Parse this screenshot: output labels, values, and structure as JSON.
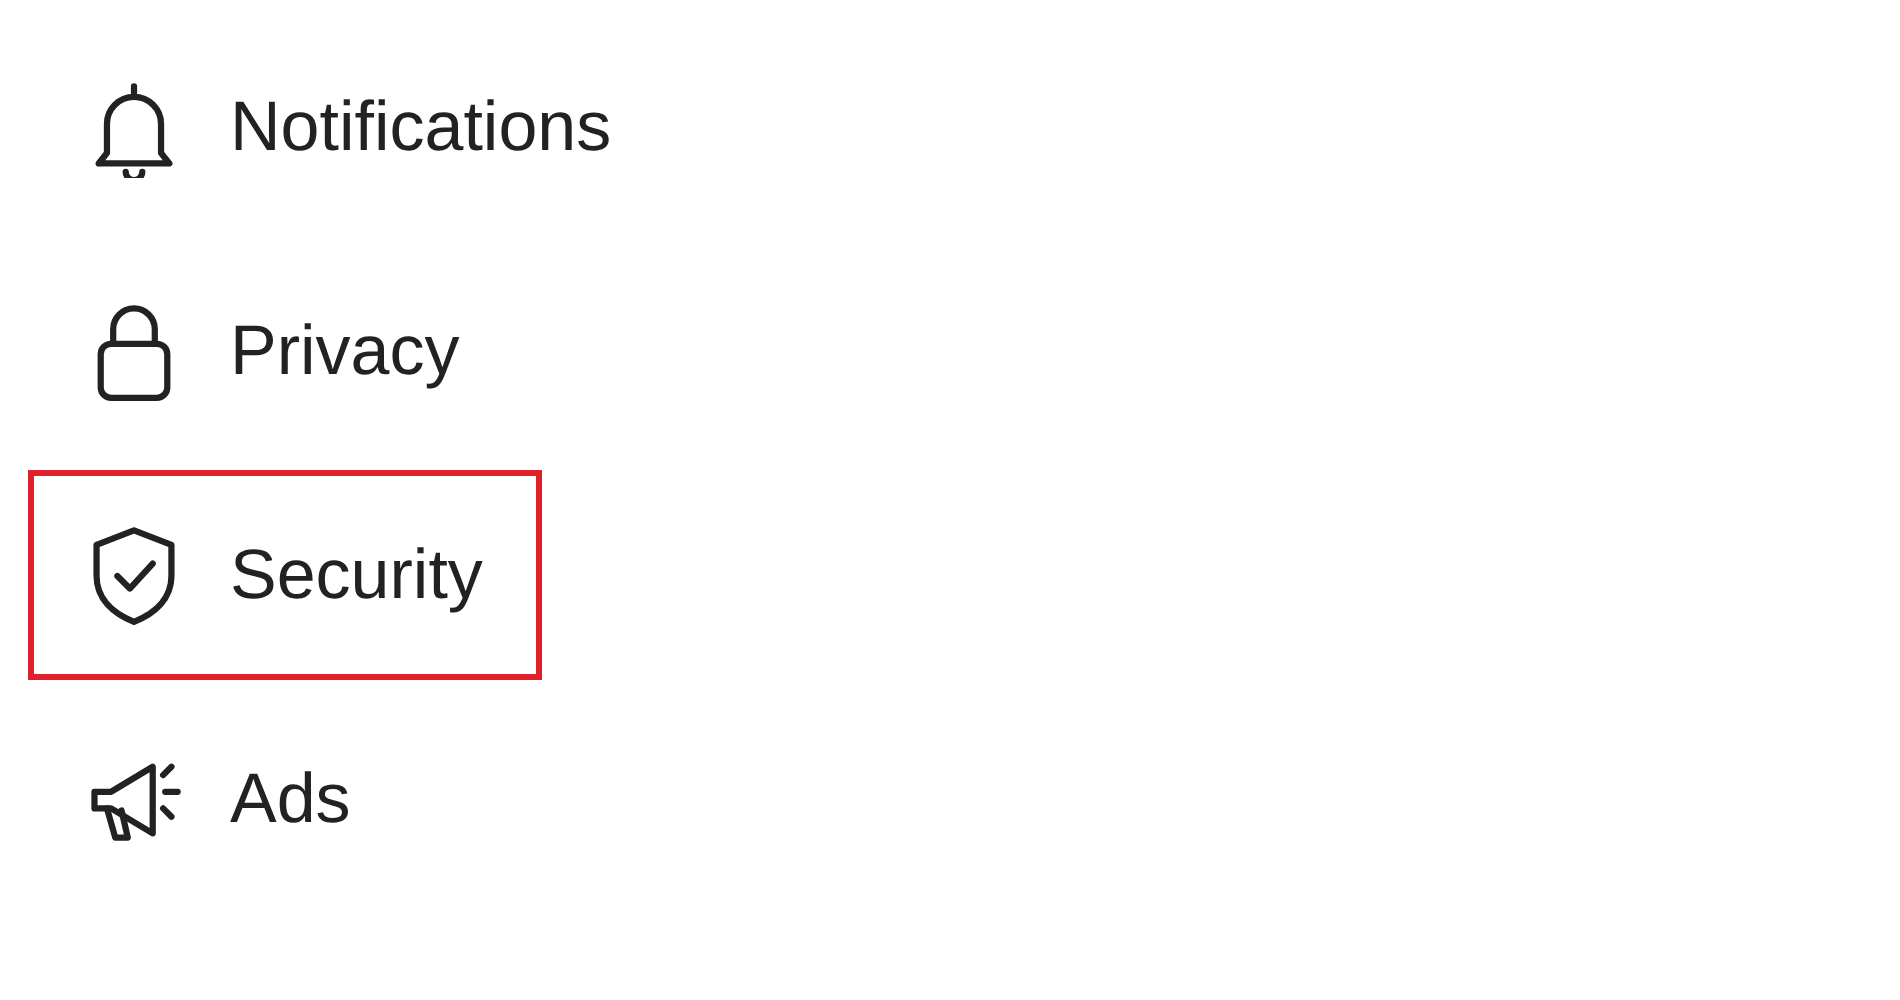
{
  "menu": {
    "items": [
      {
        "kind": "bell",
        "label": "Notifications",
        "highlighted": false
      },
      {
        "kind": "lock",
        "label": "Privacy",
        "highlighted": false
      },
      {
        "kind": "shield",
        "label": "Security",
        "highlighted": true
      },
      {
        "kind": "megaphone",
        "label": "Ads",
        "highlighted": false
      }
    ]
  }
}
